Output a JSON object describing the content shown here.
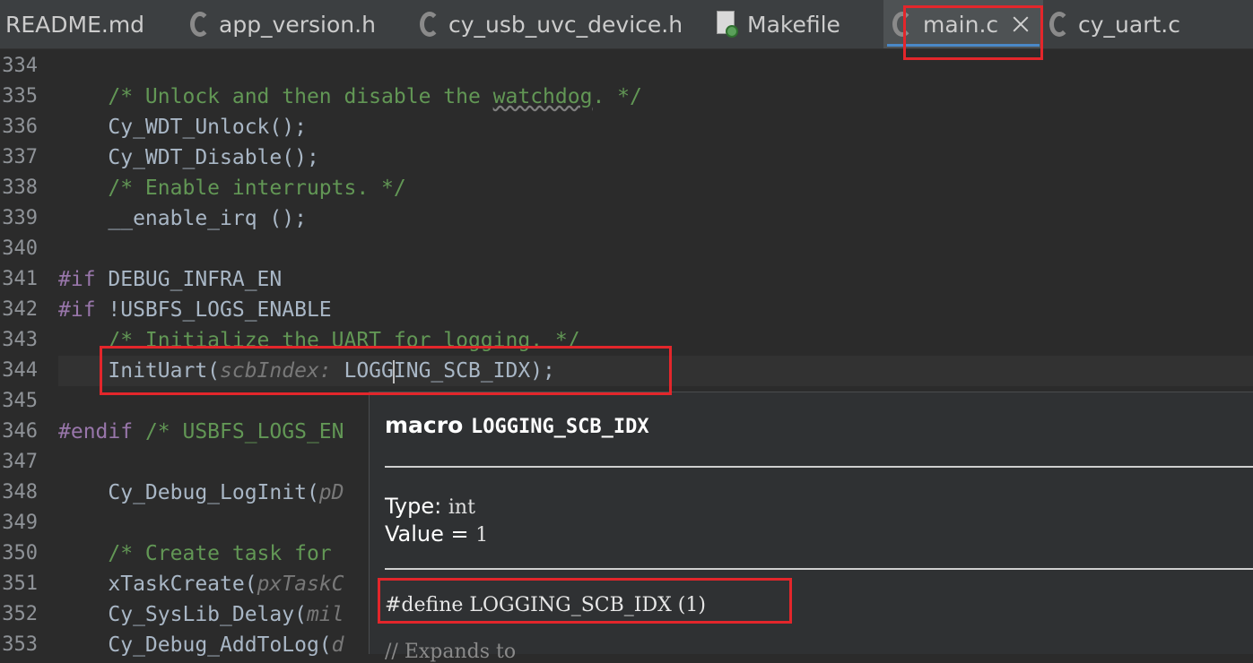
{
  "tabs": [
    {
      "label": "README.md",
      "icon": "none"
    },
    {
      "label": "app_version.h",
      "icon": "c-file-icon"
    },
    {
      "label": "cy_usb_uvc_device.h",
      "icon": "c-file-icon"
    },
    {
      "label": "Makefile",
      "icon": "makefile-icon"
    },
    {
      "label": "main.c",
      "icon": "c-file-icon",
      "active": true
    },
    {
      "label": "cy_uart.c",
      "icon": "c-file-icon"
    }
  ],
  "code": {
    "l334": {
      "n": "334"
    },
    "l335": {
      "n": "335",
      "pre": "    /* Unlock and then disable the ",
      "sq": "watchdog",
      "post": ". */"
    },
    "l336": {
      "n": "336",
      "t": "    Cy_WDT_Unlock();"
    },
    "l337": {
      "n": "337",
      "t": "    Cy_WDT_Disable();"
    },
    "l338": {
      "n": "338",
      "t": "    /* Enable interrupts. */"
    },
    "l339": {
      "n": "339",
      "t": "    __enable_irq ();"
    },
    "l340": {
      "n": "340"
    },
    "l341": {
      "n": "341",
      "kw": "#if",
      "rest": " DEBUG_INFRA_EN"
    },
    "l342": {
      "n": "342",
      "kw": "#if",
      "rest": " !USBFS_LOGS_ENABLE"
    },
    "l343": {
      "n": "343",
      "t": "    /* Initialize the UART for logging. */"
    },
    "l344": {
      "n": "344",
      "a": "    InitUart(",
      "hint": "scbIndex:",
      "b": " LOGG",
      "c": "ING_SCB_IDX);"
    },
    "l345": {
      "n": "345"
    },
    "l346": {
      "n": "346",
      "kw": "#endif",
      "cm": " /* USBFS_LOGS_EN"
    },
    "l347": {
      "n": "347"
    },
    "l348": {
      "n": "348",
      "a": "    Cy_Debug_LogInit(",
      "hint": "pD"
    },
    "l349": {
      "n": "349"
    },
    "l350": {
      "n": "350",
      "t": "    /* Create task for "
    },
    "l351": {
      "n": "351",
      "a": "    xTaskCreate(",
      "hint": "pxTaskC"
    },
    "l352": {
      "n": "352",
      "a": "    Cy_SysLib_Delay(",
      "hint": "mil"
    },
    "l353": {
      "n": "353",
      "a": "    Cy_Debug_AddToLog(",
      "hint": "d"
    }
  },
  "popup": {
    "kind": "macro",
    "name": "LOGGING_SCB_IDX",
    "type_label": "Type:",
    "type_value": "int",
    "value_label": "Value =",
    "value_value": "1",
    "define": "#define LOGGING_SCB_IDX (1)",
    "expands": "// Expands to"
  },
  "colors": {
    "background": "#2b2b2b",
    "comment": "#629755",
    "keyword": "#9876aa",
    "highlight_box": "#e3262b"
  }
}
